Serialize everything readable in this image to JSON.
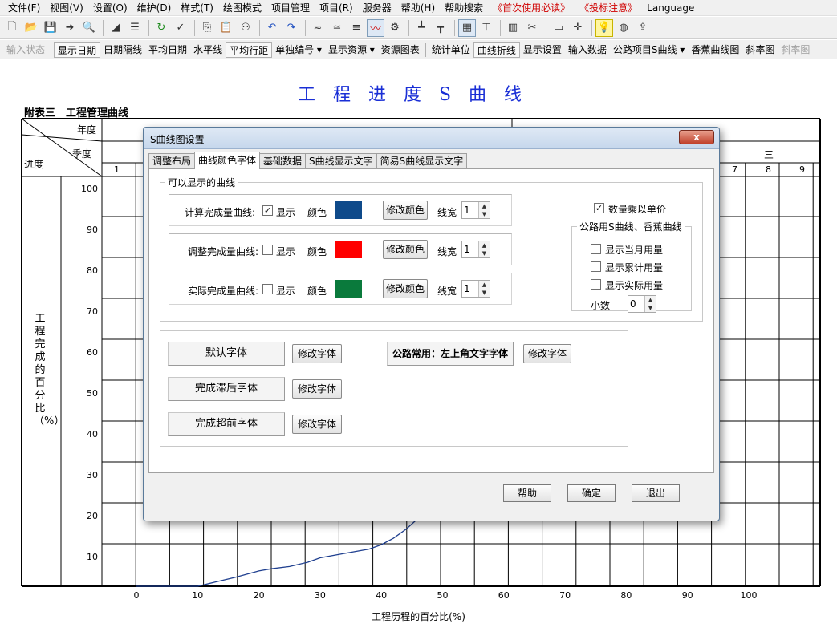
{
  "menubar": {
    "items": [
      "文件(F)",
      "视图(V)",
      "设置(O)",
      "维护(D)",
      "样式(T)",
      "绘图模式",
      "项目管理",
      "项目(R)",
      "服务器",
      "帮助(H)",
      "帮助搜索",
      "《首次使用必读》",
      "《投标注意》",
      "Language"
    ]
  },
  "toolbar": {
    "icons": [
      "new-file-icon",
      "open-folder-icon",
      "save-icon",
      "export-icon",
      "print-preview-icon",
      "fill-icon",
      "list-icon",
      "refresh-icon",
      "check-icon",
      "copy-icon",
      "paste-icon",
      "binoculars-icon",
      "undo-icon",
      "redo-icon",
      "curve1-icon",
      "curve2-icon",
      "curve3-icon",
      "line-chart-icon",
      "resource-icon",
      "bar1-icon",
      "bar2-icon",
      "grid-icon",
      "align-icon",
      "books-icon",
      "tools-icon",
      "monitor-icon",
      "cross-icon",
      "bulb-icon",
      "globe-icon",
      "export2-icon"
    ]
  },
  "textbar": {
    "items": [
      "输入状态",
      "显示日期",
      "日期隔线",
      "平均日期",
      "水平线",
      "平均行距",
      "单独编号 ▾",
      "显示资源 ▾",
      "资源图表",
      "统计单位",
      "曲线折线",
      "显示设置",
      "输入数据",
      "公路项目S曲线 ▾",
      "香蕉曲线图",
      "斜率图",
      "斜率图"
    ]
  },
  "chart": {
    "title": "工程进度S曲线",
    "appendix": "附表三　工程管理曲线",
    "header_year": "年度",
    "header_quarter": "季度",
    "header_progress": "进度",
    "quarter_three": "三",
    "months": [
      "1",
      "7",
      "8",
      "9"
    ],
    "y_ticks": [
      "100",
      "90",
      "80",
      "70",
      "60",
      "50",
      "40",
      "30",
      "20",
      "10"
    ],
    "x_ticks": [
      "0",
      "10",
      "20",
      "30",
      "40",
      "50",
      "60",
      "70",
      "80",
      "90",
      "100"
    ],
    "ylabel": "工程完成的百分比（%）",
    "xlabel": "工程历程的百分比(%)"
  },
  "chart_data": {
    "type": "line",
    "xlabel": "工程历程的百分比(%)",
    "ylabel": "工程完成的百分比（%）",
    "xlim": [
      0,
      100
    ],
    "ylim": [
      0,
      100
    ],
    "series": [
      {
        "x": [
          0,
          6,
          10,
          13,
          16,
          20,
          22,
          25,
          28,
          30,
          34,
          38,
          40,
          42,
          44,
          46
        ],
        "y": [
          0,
          0,
          0,
          1,
          2,
          3.5,
          4,
          4.5,
          5.5,
          6.5,
          7.5,
          8.5,
          9.5,
          11,
          13,
          15.5
        ]
      }
    ],
    "line_color": "#1f3f8f",
    "grid": true
  },
  "dialog": {
    "title": "S曲线图设置",
    "close_label": "x",
    "tabs": [
      "调整布局",
      "曲线颜色字体",
      "基础数据",
      "S曲线显示文字",
      "简易S曲线显示文字"
    ],
    "group_caption": "可以显示的曲线",
    "curves": [
      {
        "label": "计算完成量曲线:",
        "checked": true,
        "show": "显示",
        "color_label": "颜色",
        "color": "#0f4a8a",
        "btn": "修改颜色",
        "lw_label": "线宽",
        "lw": "1"
      },
      {
        "label": "调整完成量曲线:",
        "checked": false,
        "show": "显示",
        "color_label": "颜色",
        "color": "#ff0000",
        "btn": "修改颜色",
        "lw_label": "线宽",
        "lw": "1"
      },
      {
        "label": "实际完成量曲线:",
        "checked": false,
        "show": "显示",
        "color_label": "颜色",
        "color": "#0a7a3c",
        "btn": "修改颜色",
        "lw_label": "线宽",
        "lw": "1"
      }
    ],
    "multiply_unit": {
      "label": "数量乘以单价",
      "checked": true
    },
    "road_group": {
      "caption": "公路用S曲线、香蕉曲线",
      "options": [
        {
          "label": "显示当月用量",
          "checked": false
        },
        {
          "label": "显示累计用量",
          "checked": false
        },
        {
          "label": "显示实际用量",
          "checked": false
        }
      ],
      "decimal_label": "小数",
      "decimal_value": "0"
    },
    "fonts": {
      "rows": [
        {
          "label": "默认字体",
          "btn": "修改字体"
        },
        {
          "label": "完成滞后字体",
          "btn": "修改字体"
        },
        {
          "label": "完成超前字体",
          "btn": "修改字体"
        }
      ],
      "road_common": "公路常用：左上角文字字体",
      "road_btn": "修改字体"
    },
    "buttons": {
      "help": "帮助",
      "ok": "确定",
      "exit": "退出"
    }
  }
}
